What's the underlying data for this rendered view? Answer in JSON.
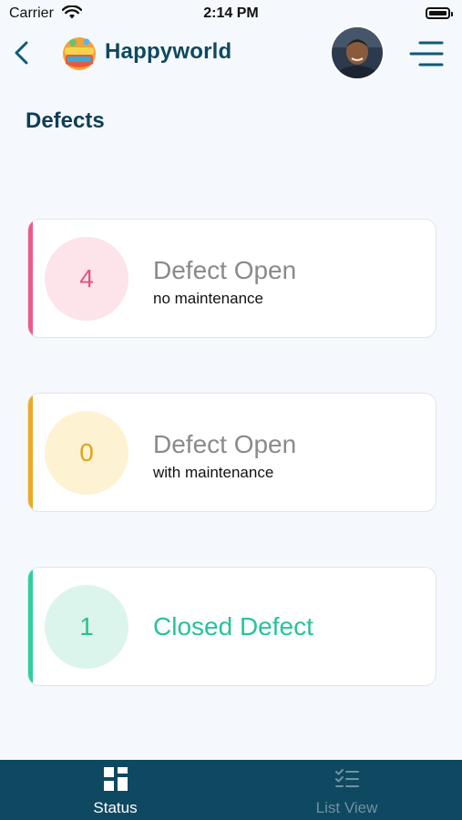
{
  "status_bar": {
    "carrier": "Carrier",
    "time": "2:14 PM"
  },
  "header": {
    "brand": "Happyworld"
  },
  "page": {
    "title": "Defects"
  },
  "cards": [
    {
      "count": "4",
      "title": "Defect Open",
      "subtitle": "no maintenance",
      "accent_color": "#ee5a8a",
      "circle_bg": "#fde3ea",
      "count_color": "#e0557f",
      "title_color": "#8a8a8a"
    },
    {
      "count": "0",
      "title": "Defect Open",
      "subtitle": "with maintenance",
      "accent_color": "#eeaa22",
      "circle_bg": "#fdf3d2",
      "count_color": "#e0a21e",
      "title_color": "#8a8a8a"
    },
    {
      "count": "1",
      "title": "Closed Defect",
      "subtitle": "",
      "accent_color": "#2ecfa0",
      "circle_bg": "#dcf5ec",
      "count_color": "#26c08f",
      "title_color": "#26c39a"
    }
  ],
  "tabbar": {
    "tabs": [
      {
        "label": "Status",
        "icon": "dashboard-icon",
        "active": true
      },
      {
        "label": "List View",
        "icon": "checklist-icon",
        "active": false
      }
    ],
    "active_color": "#ffffff",
    "inactive_color": "#6f93a3"
  }
}
